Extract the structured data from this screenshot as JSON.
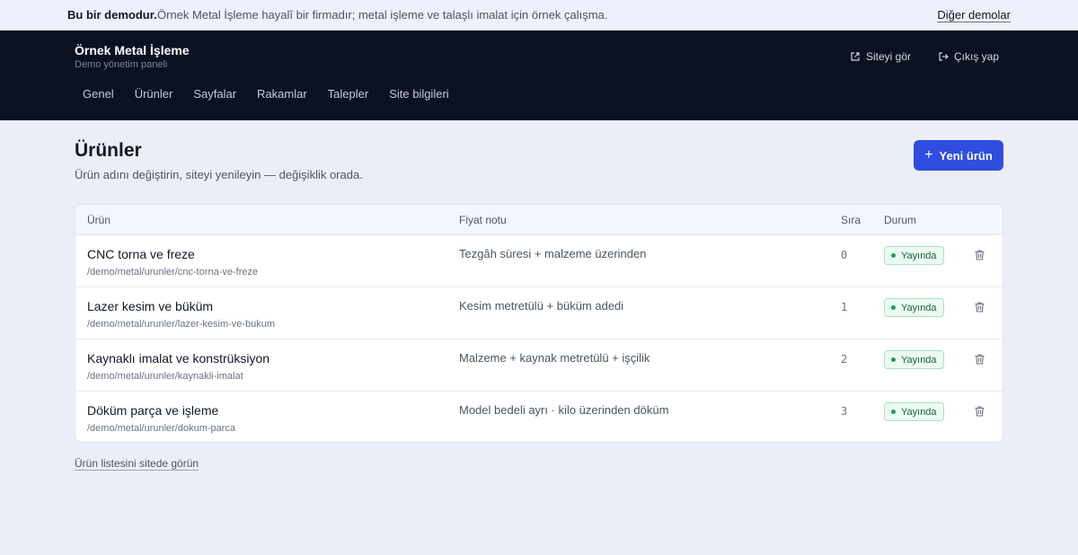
{
  "banner": {
    "strong": "Bu bir demodur.",
    "text": "Örnek Metal İşleme hayalî bir firmadır; metal işleme ve talaşlı imalat için örnek çalışma.",
    "link": "Diğer demolar"
  },
  "header": {
    "title": "Örnek Metal İşleme",
    "subtitle": "Demo yönetim paneli",
    "view_site": "Siteyi gör",
    "logout": "Çıkış yap",
    "nav": [
      "Genel",
      "Ürünler",
      "Sayfalar",
      "Rakamlar",
      "Talepler",
      "Site bilgileri"
    ]
  },
  "page": {
    "title": "Ürünler",
    "subtitle": "Ürün adını değiştirin, siteyi yenileyin — değişiklik orada.",
    "new_button": "Yeni ürün",
    "bottom_link": "Ürün listesini sitede görün"
  },
  "table": {
    "headers": {
      "product": "Ürün",
      "price": "Fiyat notu",
      "order": "Sıra",
      "status": "Durum"
    },
    "rows": [
      {
        "name": "CNC torna ve freze",
        "path": "/demo/metal/urunler/cnc-torna-ve-freze",
        "price": "Tezgâh süresi + malzeme üzerinden",
        "order": "0",
        "status": "Yayında"
      },
      {
        "name": "Lazer kesim ve büküm",
        "path": "/demo/metal/urunler/lazer-kesim-ve-bukum",
        "price": "Kesim metretülü + büküm adedi",
        "order": "1",
        "status": "Yayında"
      },
      {
        "name": "Kaynaklı imalat ve konstrüksiyon",
        "path": "/demo/metal/urunler/kaynakli-imalat",
        "price": "Malzeme + kaynak metretülü + işçilik",
        "order": "2",
        "status": "Yayında"
      },
      {
        "name": "Döküm parça ve işleme",
        "path": "/demo/metal/urunler/dokum-parca",
        "price": "Model bedeli ayrı · kilo üzerinden döküm",
        "order": "3",
        "status": "Yayında"
      }
    ]
  },
  "colors": {
    "accent": "#2f4de0",
    "header_bg": "#0c1122",
    "status_green": "#18a152"
  }
}
